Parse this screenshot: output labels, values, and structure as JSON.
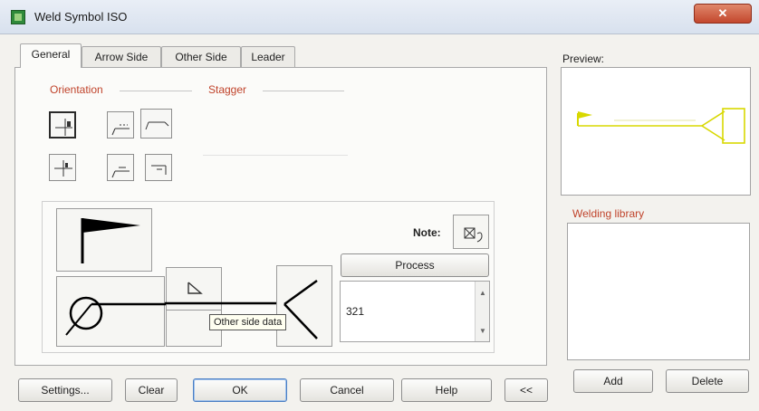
{
  "window": {
    "title": "Weld Symbol ISO",
    "close": "✕"
  },
  "tabs": [
    "General",
    "Arrow Side",
    "Other Side",
    "Leader"
  ],
  "groups": {
    "orientation": "Orientation",
    "stagger": "Stagger"
  },
  "symbol_area": {
    "note_label": "Note:",
    "process_button": "Process",
    "process_value": "321",
    "tooltip": "Other side data"
  },
  "buttons": {
    "settings": "Settings...",
    "clear": "Clear",
    "ok": "OK",
    "cancel": "Cancel",
    "help": "Help",
    "more": "<<",
    "add": "Add",
    "delete": "Delete"
  },
  "right": {
    "preview_label": "Preview:",
    "library_label": "Welding library"
  },
  "colors": {
    "group_label": "#c0432b",
    "preview_symbol": "#d8d800"
  }
}
